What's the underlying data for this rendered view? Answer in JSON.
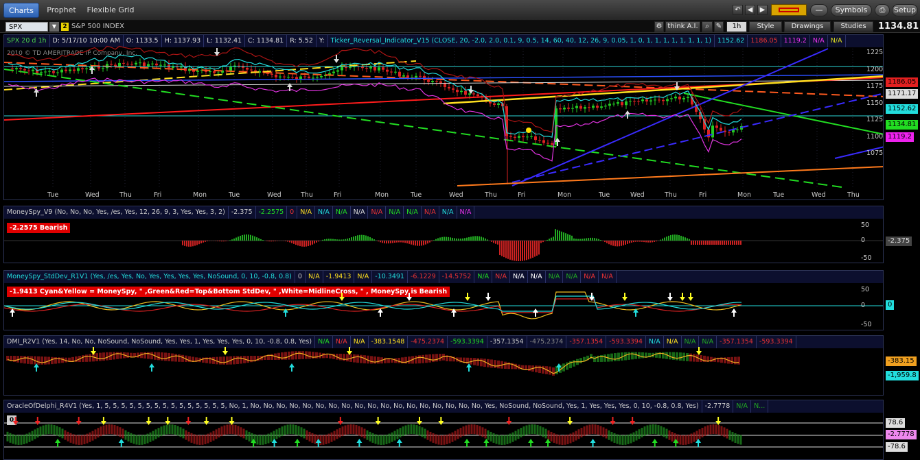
{
  "tabs": [
    {
      "label": "Charts"
    },
    {
      "label": "Prophet"
    },
    {
      "label": "Flexible Grid"
    }
  ],
  "toolbar": {
    "symbols_label": "Symbols",
    "setup_label": "Setup"
  },
  "symbol": {
    "value": "SPX",
    "link_num": "2",
    "name": "S&P 500 INDEX",
    "last": "1134.81"
  },
  "chart_tools": {
    "thinkai": "think A.I.",
    "period": "1h",
    "style": "Style",
    "drawings": "Drawings",
    "studies": "Studies"
  },
  "price_panel": {
    "header": [
      "SPX 20 d 1h",
      "D: 5/17/10 10:00 AM",
      "O: 1133.5",
      "H: 1137.93",
      "L: 1132.41",
      "C: 1134.81",
      "R: 5.52",
      "Y:",
      "Ticker_Reversal_Indicator_V15 (CLOSE, 20, -2.0, 2.0, 0.1, 9, 0.5, 14, 60, 40, 12, 26, 9, 0.05, 1, 0, 1, 1, 1, 1, 1, 1, 1, 1)",
      "1152.62",
      "1186.05",
      "1119.2",
      "N/A",
      "N/A"
    ],
    "copyright": "2010 © TD AMERITRADE IP Company, Inc.",
    "y_ticks": [
      "1225",
      "1200",
      "1175",
      "1150",
      "1125",
      "1100",
      "1075"
    ],
    "tags": [
      {
        "v": "1186.05",
        "c": "#e22020"
      },
      {
        "v": "1171.17",
        "c": "#dddddd"
      },
      {
        "v": "1152.62",
        "c": "#22dddd"
      },
      {
        "v": "1134.81",
        "c": "#22dd22"
      },
      {
        "v": "1119.2",
        "c": "#ee22ee"
      }
    ]
  },
  "x_axis": [
    "Tue",
    "Wed",
    "Thu",
    "Fri",
    "Mon",
    "Tue",
    "Wed",
    "Thu",
    "Fri",
    "Mon",
    "Tue",
    "Wed",
    "Thu",
    "Fri",
    "Mon",
    "Tue",
    "Wed",
    "Thu",
    "Fri",
    "Mon",
    "Tue",
    "Wed",
    "Thu"
  ],
  "moneyspy": {
    "header": [
      "MoneySpy_V9 (No, No, No, Yes, /es, Yes, 12, 26, 9, 3, Yes, Yes, 3, 2)",
      "-2.375",
      "-2.2575",
      "0",
      "N/A",
      "N/A",
      "N/A",
      "N/A",
      "N/A",
      "N/A",
      "N/A",
      "N/A",
      "N/A",
      "N/A"
    ],
    "status": "-2.2575 Bearish",
    "y_ticks": [
      "50",
      "0",
      "-50"
    ],
    "tag": "-2.375"
  },
  "stddev": {
    "header": [
      "MoneySpy_StdDev_R1V1 (Yes, /es, Yes, No, Yes, Yes, Yes, Yes, NoSound, 0, 10, -0.8, 0.8)",
      "0",
      "N/A",
      "-1.9413",
      "N/A",
      "-10.3491",
      "-6.1229",
      "-14.5752",
      "N/A",
      "N/A",
      "N/A",
      "N/A",
      "N/A",
      "N/A",
      "N/A",
      "N/A"
    ],
    "status": "-1.9413  Cyan&Yellow = MoneySpy, \" ,Green&Red=Top&Bottom StdDev, \" ,White=MidlineCross, \" , MoneySpy is Bearish",
    "y_ticks": [
      "50",
      "0",
      "-50"
    ],
    "tag": "0"
  },
  "dmi": {
    "header": [
      "DMI_R2V1 (Yes, 14, No, No, NoSound, NoSound, Yes, Yes, 1, Yes, Yes, Yes, 0, 10, -0.8, 0.8, Yes)",
      "N/A",
      "N/A",
      "N/A",
      "-383.1548",
      "-475.2374",
      "-593.3394",
      "-357.1354",
      "-475.2374",
      "-357.1354",
      "-593.3394",
      "N/A",
      "N/A",
      "N/A",
      "N/A",
      "-357.1354",
      "-593.3394"
    ],
    "tags": [
      "-383.15",
      "-1,959.8"
    ]
  },
  "oracle": {
    "header": [
      "OracleOfDelphi_R4V1 (Yes, 1, 5, 5, 5, 5, 5, 5, 5, 5, 5, 5, 5, 5, 5, 5, 5, No, 1, No, No, No, No, No, No, No, No, No, No, No, No, No, No, No, No, No, No, Yes, NoSound, NoSound, Yes, 1, Yes, Yes, Yes, 0, 10, -0.8, 0.8, Yes)",
      "-2.7778",
      "N/A",
      "N..."
    ],
    "status": "0",
    "tags": [
      "78.6",
      "-2.7778",
      "-78.6"
    ]
  },
  "colors": {
    "up": "#22cc22",
    "down": "#dd2222",
    "accent": "#2a5fb0"
  }
}
